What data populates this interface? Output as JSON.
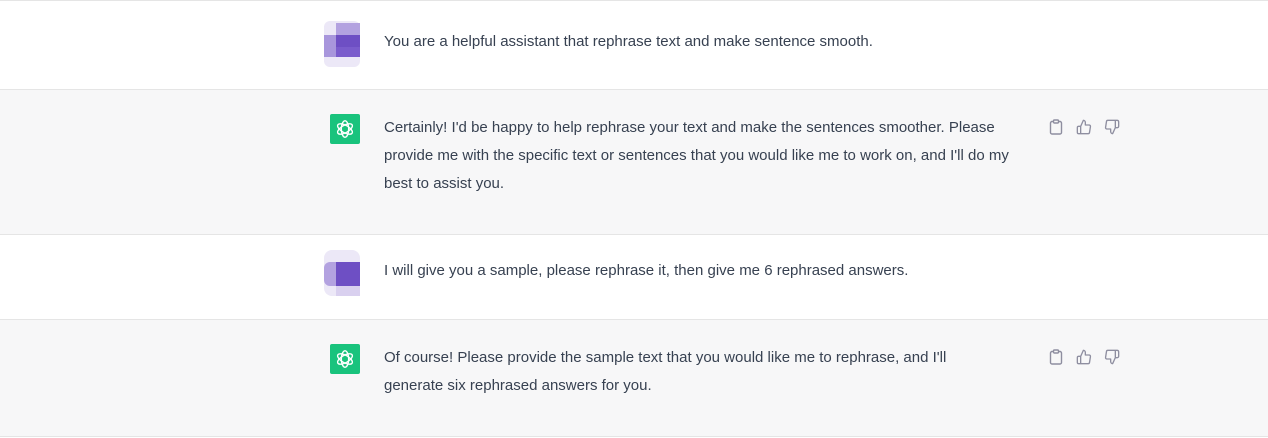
{
  "conversation": {
    "messages": [
      {
        "role": "user",
        "text": "You are a helpful assistant that rephrase text and make sentence smooth."
      },
      {
        "role": "assistant",
        "text": "Certainly! I'd be happy to help rephrase your text and make the sentences smoother. Please provide me with the specific text or sentences that you would like me to work on, and I'll do my best to assist you."
      },
      {
        "role": "user",
        "text": "I will give you a sample, please rephrase it, then give me 6 rephrased answers."
      },
      {
        "role": "assistant",
        "text": "Of course! Please provide the sample text that you would like me to rephrase, and I'll generate six rephrased answers for you."
      }
    ]
  },
  "icons": {
    "assistant_avatar": "openai-logo-icon",
    "copy": "clipboard-icon",
    "like": "thumbs-up-icon",
    "dislike": "thumbs-down-icon"
  },
  "colors": {
    "assistant_bg": "#f7f7f8",
    "user_bg": "#ffffff",
    "assistant_avatar_bg": "#19c37d",
    "user_avatar_purple": "#6e4fc4",
    "text": "#374151",
    "icon": "#8e8ea0"
  }
}
